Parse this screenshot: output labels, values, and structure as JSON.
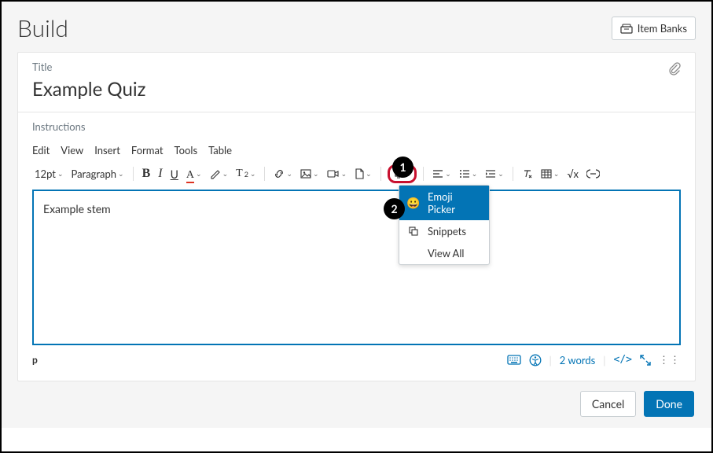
{
  "header": {
    "title": "Build",
    "item_banks_label": "Item Banks"
  },
  "title_section": {
    "label": "Title",
    "value": "Example Quiz"
  },
  "instructions": {
    "label": "Instructions"
  },
  "editor": {
    "menu": [
      "Edit",
      "View",
      "Insert",
      "Format",
      "Tools",
      "Table"
    ],
    "font_size": "12pt",
    "paragraph": "Paragraph",
    "dropdown": {
      "emoji_picker": "Emoji Picker",
      "snippets": "Snippets",
      "view_all": "View All"
    },
    "content": "Example stem"
  },
  "status_bar": {
    "path": "p",
    "word_count": "2 words"
  },
  "footer": {
    "cancel": "Cancel",
    "done": "Done"
  },
  "callouts": {
    "one": "1",
    "two": "2"
  }
}
